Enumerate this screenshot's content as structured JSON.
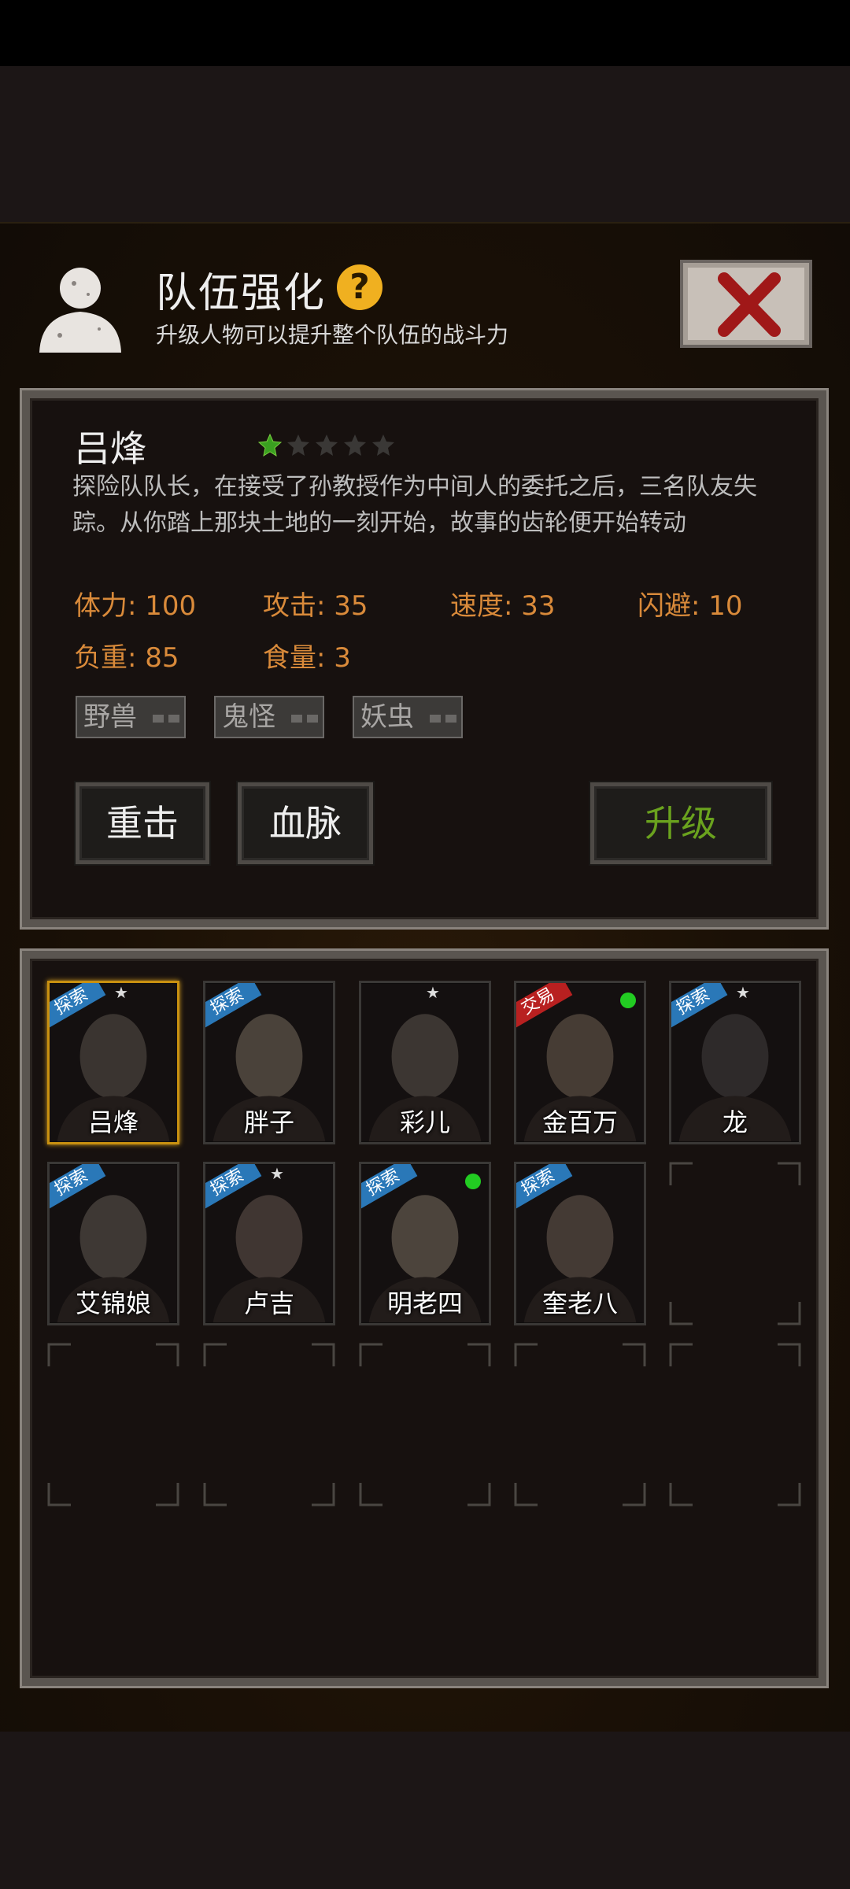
{
  "header": {
    "title": "队伍强化",
    "help_icon": "?",
    "subtitle": "升级人物可以提升整个队伍的战斗力"
  },
  "character": {
    "name": "吕烽",
    "stars_filled": 1,
    "stars_total": 5,
    "description": "探险队队长，在接受了孙教授作为中间人的委托之后，三名队友失踪。从你踏上那块土地的一刻开始，故事的齿轮便开始转动",
    "stats": {
      "hp": "体力: 100",
      "attack": "攻击: 35",
      "speed": "速度: 33",
      "dodge": "闪避: 10",
      "load": "负重: 85",
      "food": "食量: 3"
    },
    "tags": [
      "野兽",
      "鬼怪",
      "妖虫"
    ],
    "buttons": {
      "skill1": "重击",
      "skill2": "血脉",
      "upgrade": "升级"
    }
  },
  "roster": [
    {
      "name": "吕烽",
      "ribbon": "探索",
      "star": "★",
      "dot": false,
      "selected": true
    },
    {
      "name": "胖子",
      "ribbon": "探索",
      "star": "",
      "dot": false,
      "selected": false
    },
    {
      "name": "彩儿",
      "ribbon": "",
      "star": "★",
      "dot": false,
      "selected": false
    },
    {
      "name": "金百万",
      "ribbon": "交易",
      "star": "",
      "dot": true,
      "selected": false
    },
    {
      "name": "龙",
      "ribbon": "探索",
      "star": "★",
      "dot": false,
      "selected": false
    },
    {
      "name": "艾锦娘",
      "ribbon": "探索",
      "star": "",
      "dot": false,
      "selected": false
    },
    {
      "name": "卢吉",
      "ribbon": "探索",
      "star": "★",
      "dot": false,
      "selected": false
    },
    {
      "name": "明老四",
      "ribbon": "探索",
      "star": "",
      "dot": true,
      "selected": false
    },
    {
      "name": "奎老八",
      "ribbon": "探索",
      "star": "",
      "dot": false,
      "selected": false
    }
  ],
  "colors": {
    "stat_text": "#d98a3a",
    "upgrade_text": "#6aa21e",
    "explore_ribbon": "#2a78b8",
    "trade_ribbon": "#b82020",
    "star_filled": "#3aa020"
  }
}
